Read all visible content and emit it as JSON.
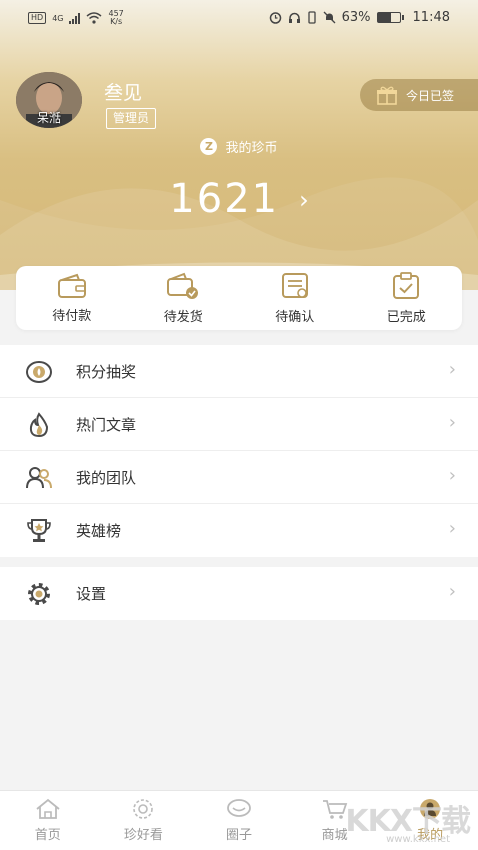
{
  "status_bar": {
    "left_badge": "HD",
    "network": "4G",
    "speed_top": "457",
    "speed_bottom": "K/s",
    "battery_text": "63%",
    "battery_level": 0.63,
    "time": "11:48"
  },
  "profile": {
    "avatar_name": "呆湉",
    "greeting": "叁见",
    "role": "管理员",
    "checkin_label": "今日已签"
  },
  "coins": {
    "label": "我的珍币",
    "value": "1621",
    "icon_glyph": "Z"
  },
  "orders": [
    {
      "label": "待付款",
      "icon": "wallet-icon"
    },
    {
      "label": "待发货",
      "icon": "package-check-icon"
    },
    {
      "label": "待确认",
      "icon": "receipt-icon"
    },
    {
      "label": "已完成",
      "icon": "clipboard-check-icon"
    }
  ],
  "menu": [
    {
      "label": "积分抽奖",
      "icon": "lottery-icon"
    },
    {
      "label": "热门文章",
      "icon": "flame-icon"
    },
    {
      "label": "我的团队",
      "icon": "team-icon"
    },
    {
      "label": "英雄榜",
      "icon": "trophy-icon"
    }
  ],
  "settings": {
    "label": "设置",
    "icon": "gear-icon"
  },
  "tabs": [
    {
      "label": "首页",
      "icon": "home-icon",
      "active": false
    },
    {
      "label": "珍好看",
      "icon": "flower-icon",
      "active": false
    },
    {
      "label": "圈子",
      "icon": "chat-icon",
      "active": false
    },
    {
      "label": "商城",
      "icon": "cart-icon",
      "active": false
    },
    {
      "label": "我的",
      "icon": "user-icon",
      "active": true
    }
  ],
  "watermark": {
    "text": "KKX下载",
    "url": "www.kkx.net"
  },
  "colors": {
    "accent": "#b89a5c",
    "header_gold": "#d5b877",
    "icon_dark": "#4a4a4a"
  }
}
